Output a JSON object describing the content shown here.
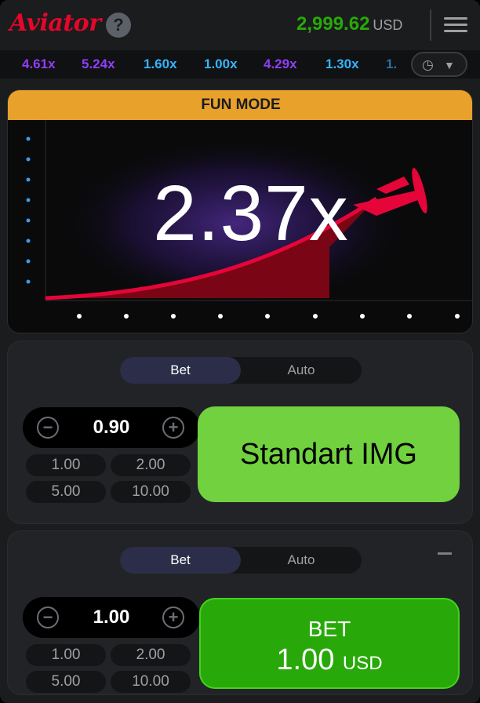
{
  "header": {
    "logo": "Aviator",
    "help_icon": "?",
    "balance": "2,999.62",
    "currency": "USD",
    "menu_icon": "hamburger-icon"
  },
  "history": {
    "items": [
      {
        "label": "4.61x",
        "color": "#913ef8"
      },
      {
        "label": "5.24x",
        "color": "#913ef8"
      },
      {
        "label": "1.60x",
        "color": "#34b4ff"
      },
      {
        "label": "1.00x",
        "color": "#34b4ff"
      },
      {
        "label": "4.29x",
        "color": "#913ef8"
      },
      {
        "label": "1.30x",
        "color": "#34b4ff"
      },
      {
        "label": "1.",
        "color": "#34b4ff"
      }
    ],
    "history_button": "clock-icon"
  },
  "game": {
    "banner": "FUN MODE",
    "multiplier": "2.37x",
    "plane_color": "#e50539"
  },
  "panel1": {
    "tabs": [
      "Bet",
      "Auto"
    ],
    "active_tab": "Bet",
    "amount": "0.90",
    "quick_amounts": [
      "1.00",
      "2.00",
      "5.00",
      "10.00"
    ],
    "overlay_label": "Standart IMG"
  },
  "panel2": {
    "tabs": [
      "Bet",
      "Auto"
    ],
    "active_tab": "Bet",
    "amount": "1.00",
    "quick_amounts": [
      "1.00",
      "2.00",
      "5.00",
      "10.00"
    ],
    "bet_button": {
      "line1": "BET",
      "amount": "1.00",
      "currency": "USD"
    }
  }
}
